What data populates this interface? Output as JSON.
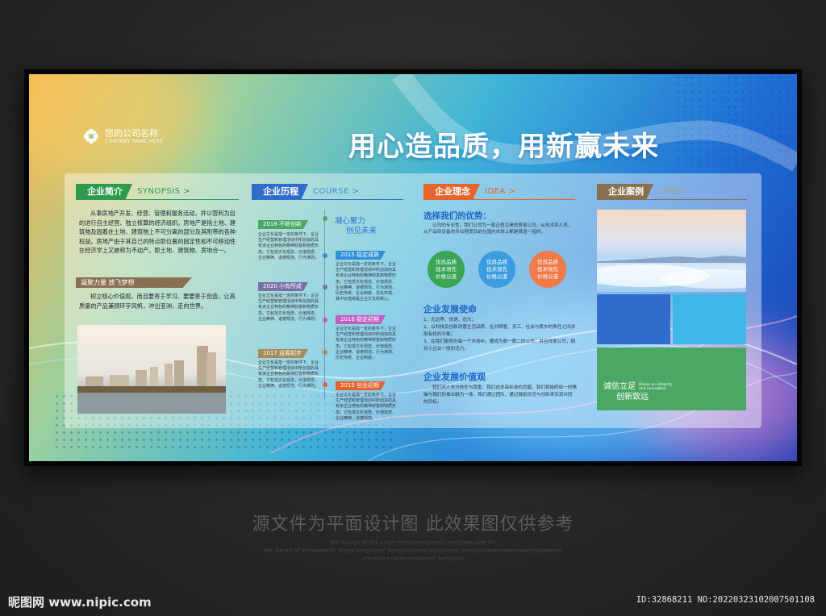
{
  "colors": {
    "green": "#2e9a4c",
    "blue": "#2f6ccc",
    "orange": "#e5642c",
    "brown": "#8a7052",
    "circle_green": "#3aa556",
    "circle_blue": "#3d9ce0",
    "circle_orange": "#ef7a4a",
    "case_green": "#4aa864"
  },
  "logo": {
    "name": "您的公司名称",
    "sub": "COMPANY NAME HERE",
    "icon": "flower-logo-icon"
  },
  "slogan": "用心造品质，用新赢未来",
  "synopsis": {
    "tag": "企业简介",
    "en": "SYNOPSIS >",
    "body": "从事房地产开发、经营、管理和服务活动，并以营利为目的进行自主经营、独立核算的经济组织。房地产是指土地、建筑物及固着在土地、建筑物上不可分离的部分及其附带的各种权益。房地产由于其自己的特点即位置的固定性和不可移动性在经济学上又被称为不动产。即土地、建筑物、房地合一。",
    "sub_tag": "凝聚力量 放飞梦想",
    "sub_body": "树立核心价值观，而且要善于学习、要要善于创造，让高质量的产品兼顾环宇风帆，冲出亚洲、走向世界。"
  },
  "course": {
    "tag": "企业历程",
    "en": "COURSE >",
    "motto_1": "凝心聚力",
    "motto_2": "创见未来",
    "items": [
      {
        "year": "2018 不断创新",
        "text": "企业文化是指一定的条件下，企业生产经营和管理活动中所创造的具有该企业特色的精神财富和物质形态。它包括文化观念、价值观念、企业精神、道德规范、行为准则。"
      },
      {
        "year": "2015 稳定成熟",
        "text": "企业文化是指一定的条件下，企业生产经营和管理活动中所创造的具有该企业特色的精神财富和物质形态。它包括文化观念、价值观念、企业精神、道德规范、行为准则、历史传统、企业制度、文化环境、其中价值观是企业文化的核心。"
      },
      {
        "year": "2020 小有所成",
        "text": "企业文化是指一定的条件下，企业生产经营和管理活动中所创造的具有该企业特色的精神财富和物质形态。它包括文化观念、价值观念、企业精神、道德规范、行为准则。"
      },
      {
        "year": "2018 稳定初期",
        "text": "企业文化是指一定的条件下，企业生产经营和管理活动中所创造的具有该企业特色的精神财富和物质形态。它包括文化观念、价值观念、企业精神、道德规范、行为准则、历史传统、企业制度。"
      },
      {
        "year": "2017 运筹起步",
        "text": "企业文化是指一定的条件下，企业生产经营和管理活动中所创造的具有该企业特色的精神财富和物质形态。它包括文化观念、价值观念、企业精神、道德规范、行为准则。"
      },
      {
        "year": "2015 创业初期",
        "text": "企业文化是指一定的条件下，企业生产经营和管理活动中所创造的具有该企业特色的精神财富和物质形态。它包括文化观念、价值观念、企业精神、道德规范。"
      }
    ]
  },
  "idea": {
    "tag": "企业理念",
    "en": "IDEA >",
    "adv_title": "选择我们的优势：",
    "adv_body": "公司的专业性，我们公司为一家正规注册的贸易公司，从技术到人员，从产品到设备的专业程度目前在国内市场上都是首屈一指的。",
    "circles": [
      {
        "l1": "优良品质",
        "l2": "技术领先",
        "l3": "价格公道"
      },
      {
        "l1": "优良品质",
        "l2": "技术领先",
        "l3": "价格公道"
      },
      {
        "l1": "优良品质",
        "l2": "技术领先",
        "l3": "价格公道"
      }
    ],
    "mission_title": "企业发展使命",
    "mission": [
      "1、无边界、快速、远大；",
      "2、以科技及创新改善生活品质，在对顾客、员工、社会与股东的责任之间求取有机的平衡；",
      "3、在我们服务的每一个市场中，要成为数一数二的公司，并且改革公司，拥有小企业一般的活力。"
    ],
    "values_title": "企业发展价值观",
    "values_body": "我们对人充分信任与尊重，我们追求高标准的贡献，我们将始终如一的情操与我们的事业融为一体，我们通过团队，通过鼓励灵活与创新来实现共同的目标。"
  },
  "case": {
    "tag": "企业案例",
    "en": "CASE >",
    "motto_1": "诚信立足",
    "motto_2": "创新致远",
    "motto_en_1": "Based on integrity",
    "motto_en_2": "and innovation"
  },
  "watermark": {
    "cn": "源文件为平面设计图 此效果图仅供参考",
    "en_1": "the design of the cover templatesphenic templatesphe for",
    "en_2": "the album of atmospheric templatesphenic templatetemplatesphenic templatetemplatephatemplatemsel",
    "en_3": "creative enterprisespheric template"
  },
  "site": {
    "name": "昵图网 www.nipic.com",
    "id": "ID:32868211 NO:20220323102007501108"
  }
}
